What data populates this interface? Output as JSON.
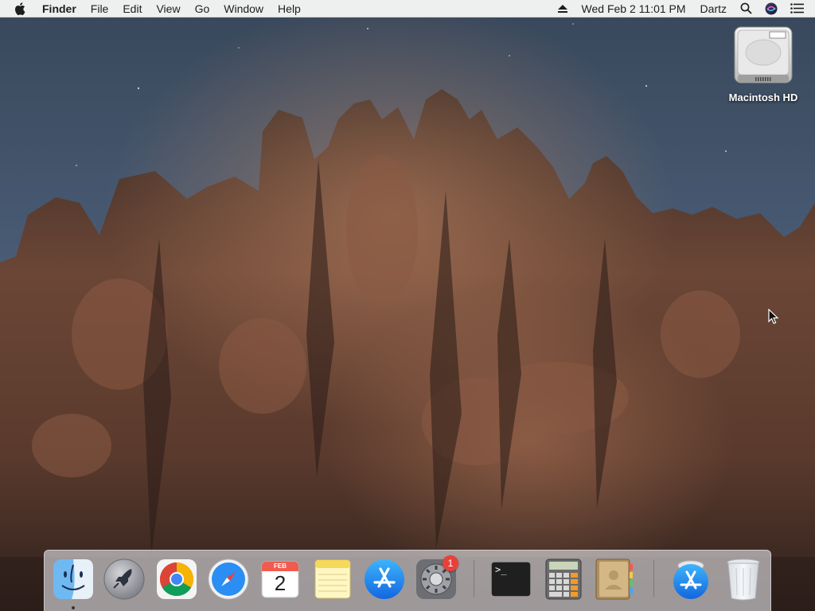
{
  "menubar": {
    "app_name": "Finder",
    "menus": [
      "File",
      "Edit",
      "View",
      "Go",
      "Window",
      "Help"
    ],
    "clock": "Wed Feb 2  11:01 PM",
    "user": "Dartz",
    "status_icons": [
      "eject-icon",
      "spotlight-search-icon",
      "siri-icon",
      "notification-center-icon"
    ]
  },
  "desktop": {
    "icons": [
      {
        "label": "Macintosh HD",
        "icon": "hard-drive-icon"
      }
    ]
  },
  "dock": {
    "apps": [
      {
        "name": "Finder",
        "icon": "finder-icon",
        "running": true
      },
      {
        "name": "Launchpad",
        "icon": "launchpad-icon"
      },
      {
        "name": "Google Chrome",
        "icon": "chrome-icon"
      },
      {
        "name": "Safari",
        "icon": "safari-icon"
      },
      {
        "name": "Calendar",
        "icon": "calendar-icon",
        "month": "FEB",
        "day": "2"
      },
      {
        "name": "Notes",
        "icon": "notes-icon"
      },
      {
        "name": "App Store",
        "icon": "app-store-icon"
      },
      {
        "name": "System Preferences",
        "icon": "system-preferences-icon",
        "badge": "1"
      },
      {
        "name": "Terminal",
        "icon": "terminal-icon",
        "prompt": ">_"
      },
      {
        "name": "Calculator",
        "icon": "calculator-icon"
      },
      {
        "name": "Contacts",
        "icon": "contacts-icon"
      },
      {
        "name": "App Store Downloads",
        "icon": "app-store-download-icon"
      },
      {
        "name": "Trash",
        "icon": "trash-icon"
      }
    ]
  }
}
